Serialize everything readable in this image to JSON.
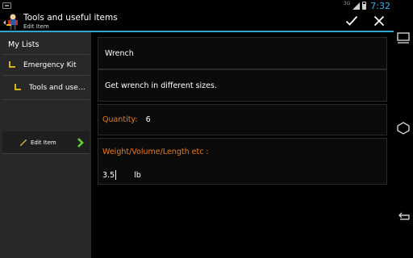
{
  "status_bar": {
    "network": "3G",
    "time": "7:32",
    "accent_color": "#33b5e5"
  },
  "action_bar": {
    "title": "Tools and useful items",
    "subtitle": "Edit Item",
    "app_icon": "app-icon",
    "confirm_icon": "checkmark-icon",
    "close_icon": "close-icon",
    "divider_color": "#2aa6d5"
  },
  "sidebar": {
    "items": [
      {
        "label": "My Lists"
      },
      {
        "label": "Emergency Kit",
        "icon": "folder-corner-icon"
      },
      {
        "label": "Tools and useful items",
        "icon": "folder-corner-icon"
      },
      {
        "label": "Edit Item",
        "icon": "pencil-icon",
        "trailing_icon": "chevron-right-icon",
        "selected": true
      }
    ],
    "folder_color": "#d8b515",
    "chevron_color": "#5fd332"
  },
  "item_form": {
    "name_value": "Wrench",
    "description_value": "Get wrench in different sizes.",
    "quantity_label": "Quantity:",
    "quantity_value": "6",
    "measure_label": "Weight/Volume/Length etc :",
    "measure_value": "3.5",
    "measure_unit": "lb",
    "label_color": "#ea7a1e"
  },
  "nav_bar": {
    "icons": [
      "recent-apps-icon",
      "home-icon",
      "back-icon"
    ]
  }
}
